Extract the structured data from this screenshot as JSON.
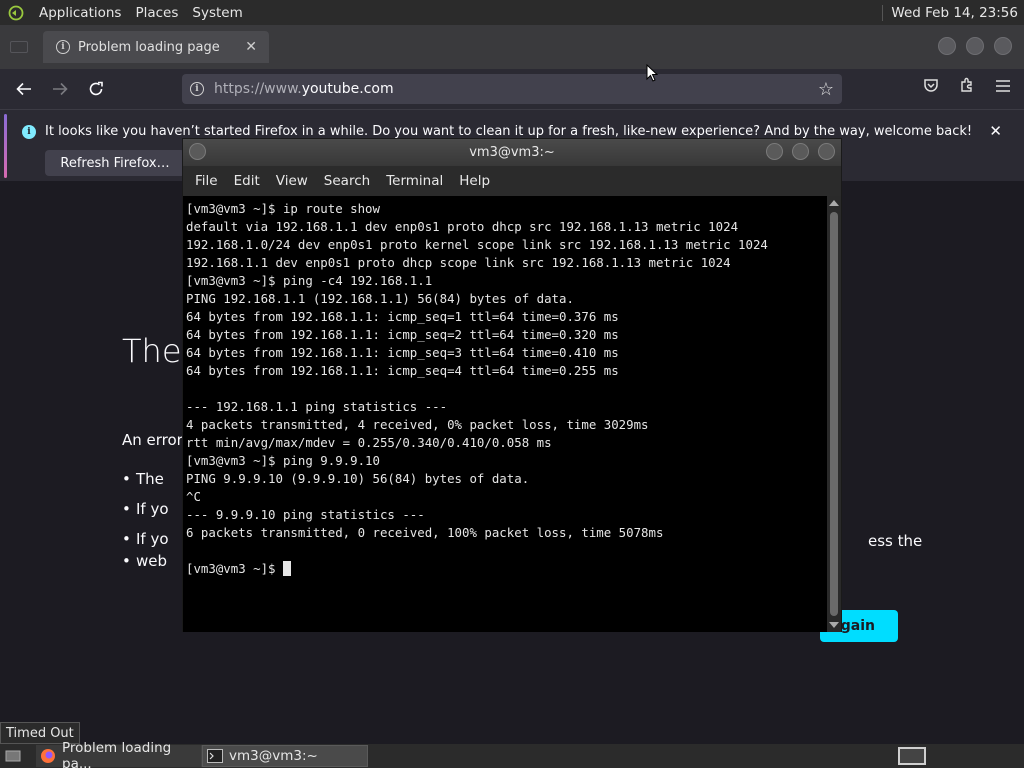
{
  "top_panel": {
    "menus": [
      "Applications",
      "Places",
      "System"
    ],
    "clock": "Wed Feb 14, 23:56"
  },
  "firefox": {
    "tab_title": "Problem loading page",
    "url_prefix": "https://www.",
    "url_domain": "youtube.com",
    "notification": {
      "message": "It looks like you haven’t started Firefox in a while. Do you want to clean it up for a fresh, like-new experience? And by the way, welcome back!",
      "button": "Refresh Firefox…"
    },
    "page": {
      "title_fragment": "The",
      "desc_fragment": "An error",
      "bullets": [
        "The",
        "If yo",
        "If yo"
      ],
      "bullet3_line2": "web",
      "bullet3_tail": "ess the",
      "try_again_fragment": "Again"
    }
  },
  "terminal": {
    "title": "vm3@vm3:~",
    "menu": [
      "File",
      "Edit",
      "View",
      "Search",
      "Terminal",
      "Help"
    ],
    "lines": [
      "[vm3@vm3 ~]$ ip route show",
      "default via 192.168.1.1 dev enp0s1 proto dhcp src 192.168.1.13 metric 1024",
      "192.168.1.0/24 dev enp0s1 proto kernel scope link src 192.168.1.13 metric 1024",
      "192.168.1.1 dev enp0s1 proto dhcp scope link src 192.168.1.13 metric 1024",
      "[vm3@vm3 ~]$ ping -c4 192.168.1.1",
      "PING 192.168.1.1 (192.168.1.1) 56(84) bytes of data.",
      "64 bytes from 192.168.1.1: icmp_seq=1 ttl=64 time=0.376 ms",
      "64 bytes from 192.168.1.1: icmp_seq=2 ttl=64 time=0.320 ms",
      "64 bytes from 192.168.1.1: icmp_seq=3 ttl=64 time=0.410 ms",
      "64 bytes from 192.168.1.1: icmp_seq=4 ttl=64 time=0.255 ms",
      "",
      "--- 192.168.1.1 ping statistics ---",
      "4 packets transmitted, 4 received, 0% packet loss, time 3029ms",
      "rtt min/avg/max/mdev = 0.255/0.340/0.410/0.058 ms",
      "[vm3@vm3 ~]$ ping 9.9.9.10",
      "PING 9.9.9.10 (9.9.9.10) 56(84) bytes of data.",
      "^C",
      "--- 9.9.9.10 ping statistics ---",
      "6 packets transmitted, 0 received, 100% packet loss, time 5078ms",
      ""
    ],
    "prompt": "[vm3@vm3 ~]$ "
  },
  "bottom_panel": {
    "tooltip": "Timed Out",
    "tasks": [
      "Problem loading pa...",
      "vm3@vm3:~"
    ]
  },
  "colors": {
    "accent": "#00ddff",
    "page_bg": "#1c1b22",
    "terminal_bg": "#000000"
  },
  "icons": [
    "info-icon",
    "close-icon",
    "back-arrow-icon",
    "forward-arrow-icon",
    "reload-icon",
    "star-icon",
    "pocket-icon",
    "extensions-icon",
    "menu-icon",
    "firefox-icon",
    "terminal-icon",
    "show-desktop-icon",
    "workspace-icon"
  ]
}
